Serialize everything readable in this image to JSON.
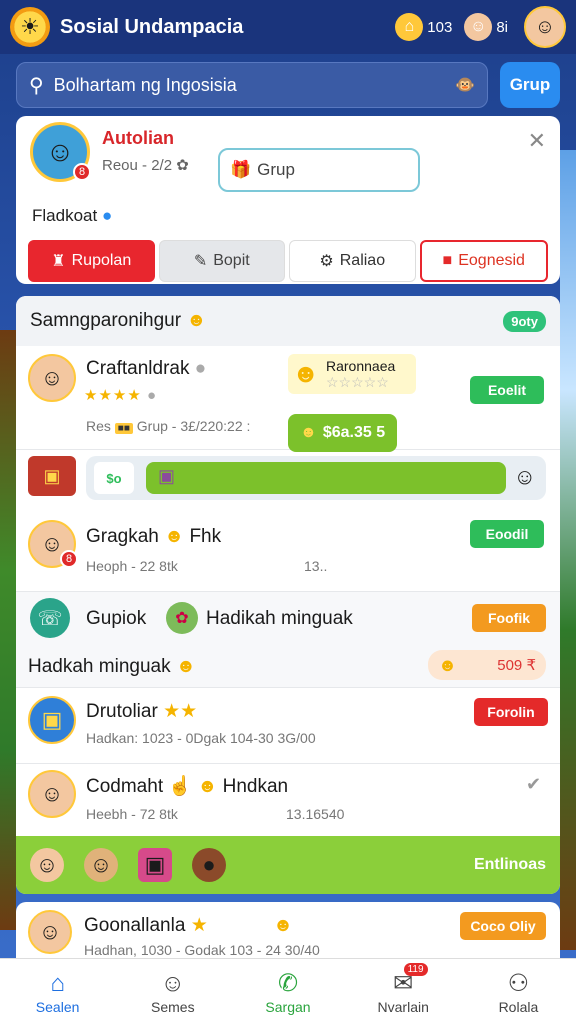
{
  "header": {
    "title": "Sosial Undampacia",
    "coins": "103",
    "friends": "8i"
  },
  "search": {
    "value": "Bolhartam ng Ingosisia",
    "button_label": "Grup"
  },
  "profile": {
    "name": "Autolian",
    "subtitle": "Reou - 2/2",
    "group_input": "Grup",
    "badge": "8",
    "label": "Fladkoat",
    "actions": [
      {
        "label": "Rupolan",
        "icon": "gift-icon"
      },
      {
        "label": "Bopit",
        "icon": "chat-icon"
      },
      {
        "label": "Raliao",
        "icon": "puzzle-icon"
      },
      {
        "label": "Eognesid",
        "icon": "flag-icon"
      }
    ]
  },
  "list": {
    "section_title": "Samngparonihgur",
    "section_pill": "9oty",
    "row1": {
      "name": "Craftanldrak",
      "sub_prefix": "Res",
      "sub": "Grup - 3£/220:22 :",
      "button": "Eoelit",
      "promo_title": "Raronnaea",
      "score": "$6a.35 5",
      "progress_label": "$o"
    },
    "row2": {
      "name": "Gragkah",
      "name_suffix": "Fhk",
      "sub": "Heoph - 22 8tk",
      "sub_right": "13..",
      "button": "Eoodil",
      "badge": "8"
    },
    "row3": {
      "name": "Gupiok",
      "middle": "Hadikah minguak",
      "button": "Foofik"
    },
    "row4": {
      "label": "Hadkah minguak",
      "reward": "509 ₹"
    },
    "row5": {
      "name": "Drutoliar",
      "sub": "Hadkan: 1023 - 0Dgak 104-30 3G/00",
      "button": "Forolin"
    },
    "row6": {
      "name": "Codmaht",
      "name_suffix": "Hndkan",
      "sub": "Heebh - 72 8tk",
      "sub_right": "13.16540"
    },
    "green_bar_label": "Entlinoas"
  },
  "bottom_row": {
    "name": "Goonallanla",
    "sub": "Hadhan, 1030 - Godak 103 - 24 30/40",
    "button": "Coco Oliy"
  },
  "nav": {
    "items": [
      {
        "label": "Sealen",
        "icon": "home-icon"
      },
      {
        "label": "Semes",
        "icon": "smile-icon"
      },
      {
        "label": "Sargan",
        "icon": "phone-icon"
      },
      {
        "label": "Nvarlain",
        "icon": "inbox-icon",
        "badge": "119"
      },
      {
        "label": "Rolala",
        "icon": "profile-icon"
      }
    ]
  },
  "colors": {
    "accent_blue": "#2a8cf0",
    "header_bg": "#1a347c",
    "green": "#2ebd5a",
    "red": "#e42a2a",
    "orange": "#f39a1f"
  }
}
